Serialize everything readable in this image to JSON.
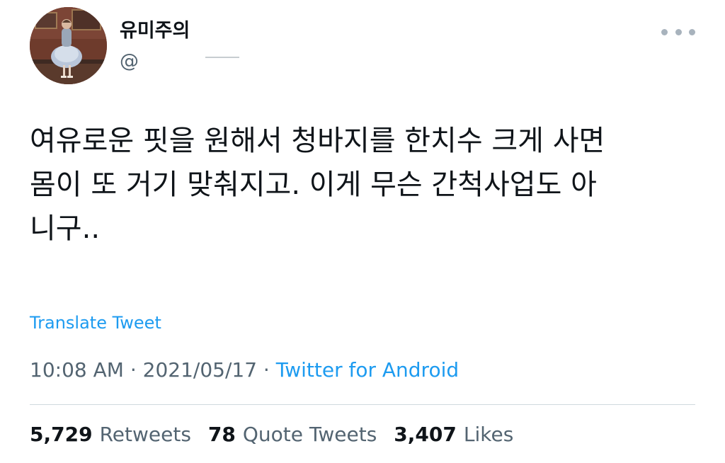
{
  "user": {
    "display_name": "유미주의",
    "handle": "@"
  },
  "tweet": {
    "lines": [
      "여유로운 핏을 원해서 청바지를 한치수 크게 사면",
      "몸이 또 거기 맞춰지고. 이게 무슨 간척사업도 아",
      "니구.."
    ],
    "translate_label": "Translate Tweet",
    "time": "10:08 AM",
    "date": "2021/05/17",
    "separator": "·",
    "source": "Twitter for Android"
  },
  "stats": {
    "retweets_count": "5,729",
    "retweets_label": "Retweets",
    "quote_count": "78",
    "quote_label": "Quote Tweets",
    "likes_count": "3,407",
    "likes_label": "Likes"
  },
  "colors": {
    "accent": "#1d9bf0",
    "secondary_text": "#536471",
    "primary_text": "#0f1419",
    "divider": "#cfd9de"
  },
  "icons": {
    "more": "more-horizontal-icon"
  }
}
